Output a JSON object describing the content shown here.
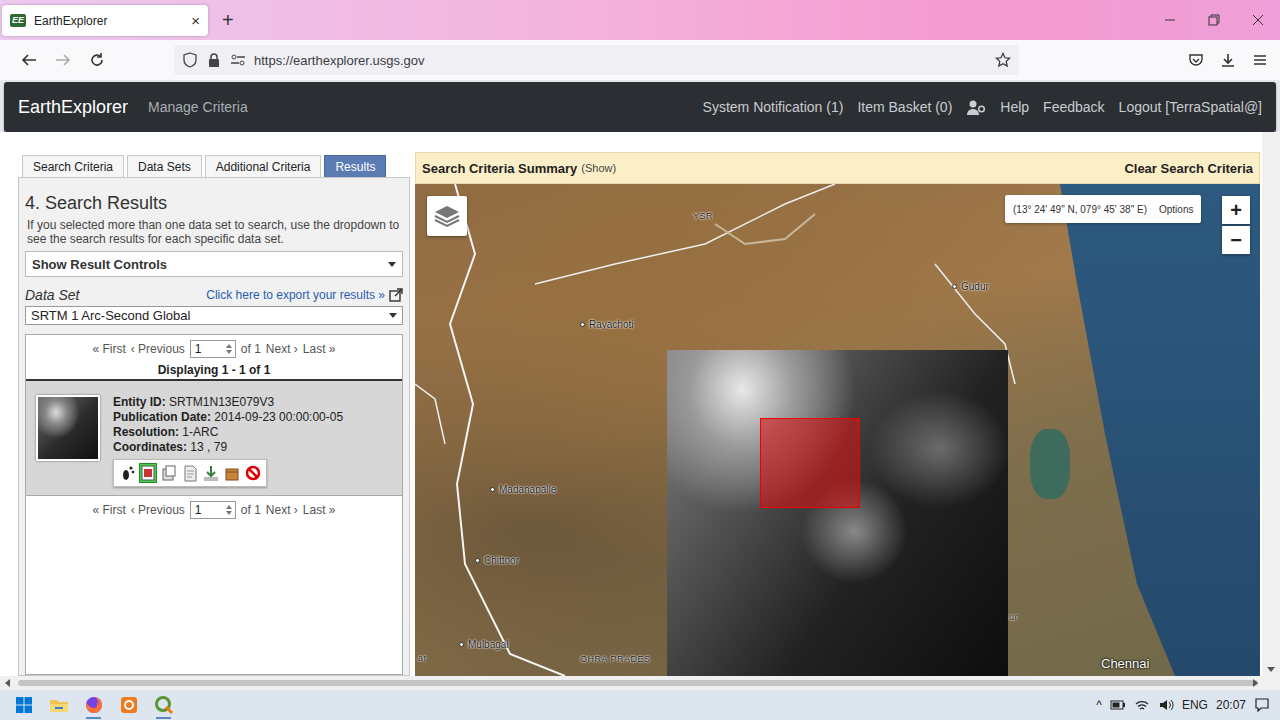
{
  "browser": {
    "tab": {
      "favicon": "EE",
      "title": "EarthExplorer",
      "close": "×",
      "selected": true
    },
    "new_tab": "+",
    "url": "https://earthexplorer.usgs.gov"
  },
  "header": {
    "brand": "EarthExplorer",
    "manage": "Manage Criteria",
    "links": [
      {
        "label": "System Notification (1)"
      },
      {
        "label": "Item Basket (0)"
      },
      {
        "label": "Help"
      },
      {
        "label": "Feedback"
      },
      {
        "label": "Logout [TerraSpatial@]"
      }
    ]
  },
  "tabs": [
    {
      "label": "Search Criteria",
      "selected": false
    },
    {
      "label": "Data Sets",
      "selected": false
    },
    {
      "label": "Additional Criteria",
      "selected": false
    },
    {
      "label": "Results",
      "selected": true
    }
  ],
  "results": {
    "heading": "4. Search Results",
    "note": "If you selected more than one data set to search, use the dropdown to see the search results for each specific data set.",
    "controls": "Show Result Controls",
    "dataset_label": "Data Set",
    "export": "Click here to export your results »",
    "dataset": "SRTM 1 Arc-Second Global",
    "pager": {
      "first": "« First",
      "prev": "‹ Previous",
      "page": "1",
      "of": "of 1",
      "next": "Next ›",
      "last": "Last »"
    },
    "displaying": "Displaying 1 - 1 of 1",
    "items": [
      {
        "fields": [
          {
            "label": "Entity ID:",
            "value": "SRTM1N13E079V3"
          },
          {
            "label": "Publication Date:",
            "value": "2014-09-23 00:00:00-05"
          },
          {
            "label": "Resolution:",
            "value": "1-ARC"
          },
          {
            "label": "Coordinates:",
            "value": "13 , 79"
          }
        ],
        "actions": [
          {
            "kind": "footprint",
            "selected": false
          },
          {
            "kind": "overlay",
            "selected": true
          },
          {
            "kind": "compare",
            "selected": false
          },
          {
            "kind": "metadata",
            "selected": false
          },
          {
            "kind": "download",
            "selected": false
          },
          {
            "kind": "order",
            "selected": false
          },
          {
            "kind": "exclude",
            "selected": false
          }
        ]
      }
    ]
  },
  "map": {
    "summary": "Search Criteria Summary",
    "show": "(Show)",
    "clear": "Clear Search Criteria",
    "coords": "(13° 24' 49\" N, 079° 45' 38\" E)",
    "options": "Options",
    "zoom_in": "+",
    "zoom_out": "−",
    "labels": [
      {
        "text": "YSR",
        "kind": "area"
      },
      {
        "text": "Gudur",
        "kind": "town"
      },
      {
        "text": "Rayachoti",
        "kind": "town"
      },
      {
        "text": "Madanapalle",
        "kind": "town"
      },
      {
        "text": "Chittoor",
        "kind": "town"
      },
      {
        "text": "Mulbagal",
        "kind": "town"
      },
      {
        "text": "Chennai",
        "kind": "city"
      },
      {
        "text": "ar",
        "kind": "area"
      },
      {
        "text": "OHRA PRADES",
        "kind": "area"
      },
      {
        "text": "ur",
        "kind": "area"
      }
    ]
  },
  "taskbar": {
    "tray": {
      "caret": "^",
      "language": "ENG",
      "time": "20:07"
    }
  }
}
